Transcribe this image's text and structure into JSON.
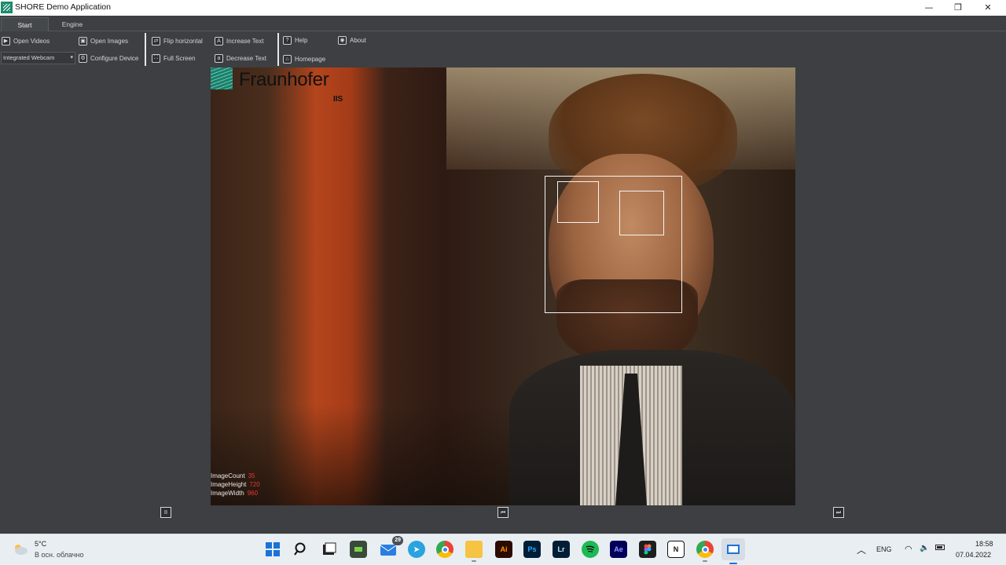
{
  "window": {
    "title": "SHORE Demo Application",
    "minimize": "—",
    "maximize": "❐",
    "close": "✕"
  },
  "tabs": [
    {
      "label": "Start"
    },
    {
      "label": "Engine"
    }
  ],
  "ribbon": {
    "open_videos": "Open Videos",
    "open_images": "Open Images",
    "flip_horizontal": "Flip horizontal",
    "increase_text": "Increase Text",
    "help": "Help",
    "about": "About",
    "device_select": "Integrated Webcam",
    "configure_device": "Configure Device",
    "full_screen": "Full Screen",
    "decrease_text": "Decrease Text",
    "homepage": "Homepage"
  },
  "viewer": {
    "logo_text": "Fraunhofer",
    "logo_sub": "IIS",
    "stats": [
      {
        "label": "ImageCount",
        "value": "35"
      },
      {
        "label": "ImageHeight",
        "value": "720"
      },
      {
        "label": "ImageWidth",
        "value": "960"
      }
    ]
  },
  "controls": {
    "pause": "II",
    "rewind": "⏮",
    "forward": "⏭"
  },
  "taskbar": {
    "weather_temp": "5°C",
    "weather_desc": "В осн. облачно",
    "mail_badge": "29",
    "apps": [
      "start-icon",
      "search-icon",
      "task-view-icon",
      "app-icon",
      "mail-icon",
      "telegram-icon",
      "chrome-icon",
      "explorer-icon",
      "illustrator-icon",
      "photoshop-icon",
      "lightroom-icon",
      "spotify-icon",
      "after-effects-icon",
      "figma-icon",
      "notion-icon",
      "chrome-icon",
      "shore-icon"
    ],
    "illustrator_label": "Ai",
    "photoshop_label": "Ps",
    "lightroom_label": "Lr",
    "after_effects_label": "Ae",
    "notion_label": "N",
    "language": "ENG",
    "time": "18:58",
    "date": "07.04.2022"
  }
}
